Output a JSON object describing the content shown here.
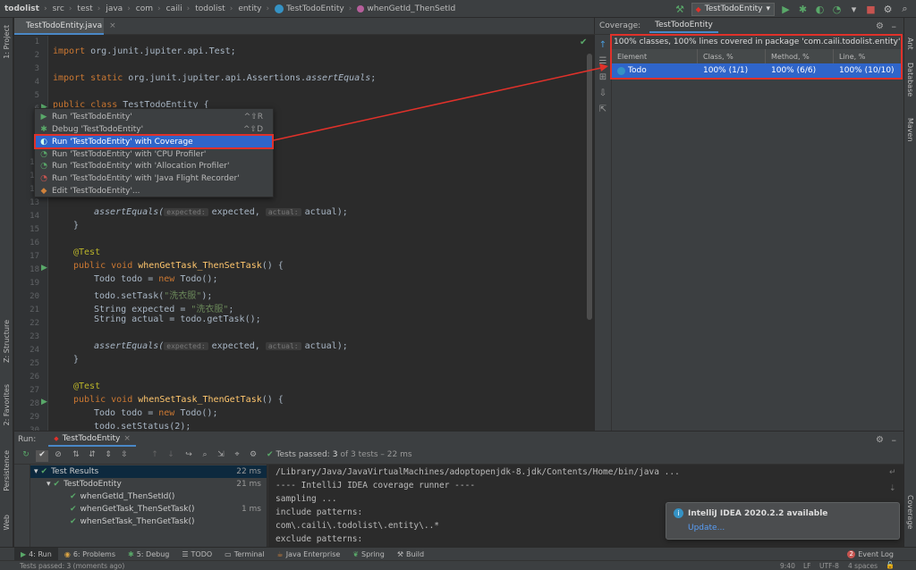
{
  "navbar": {
    "breadcrumbs": [
      "todolist",
      "src",
      "test",
      "java",
      "com",
      "caili",
      "todolist",
      "entity",
      "TestTodoEntity",
      "whenGetId_ThenSetId"
    ],
    "run_config": "TestTodoEntity"
  },
  "left_stripe": {
    "project": "1: Project",
    "structure": "Z: Structure",
    "favorites": "2: Favorites",
    "persistence": "Persistence",
    "web": "Web"
  },
  "right_stripe": {
    "ant": "Ant",
    "database": "Database",
    "maven": "Maven",
    "coverage": "Coverage"
  },
  "editor": {
    "tab": "TestTodoEntity.java",
    "line_numbers": [
      "1",
      "2",
      "3",
      "4",
      "5",
      "6",
      "7",
      "8",
      "9",
      "10",
      "11",
      "12",
      "13",
      "14",
      "15",
      "16",
      "17",
      "18",
      "19",
      "20",
      "21",
      "22",
      "23",
      "24",
      "25",
      "26",
      "27",
      "28",
      "29",
      "30"
    ],
    "lines": {
      "l2_kw": "import",
      "l2_rest": " org.junit.jupiter.api.Test;",
      "l4_kw": "import static",
      "l4_rest": " org.junit.jupiter.api.Assertions.",
      "l4_fn": "assertEquals",
      "l4_end": ";",
      "l6_kw": "public class",
      "l6_rest": " TestTodoEntity {",
      "l14_fn": "assertEquals(",
      "l14_h1": "expected:",
      "l14_a": "expected,",
      "l14_h2": "actual:",
      "l14_b": "actual);",
      "l15": "}",
      "l17": "@Test",
      "l18_kw": "public void",
      "l18_fn": "whenGetTask_ThenSetTask",
      "l18_end": "() {",
      "l19_a": "Todo todo = ",
      "l19_kw": "new",
      "l19_b": " Todo();",
      "l20_a": "todo.setTask(",
      "l20_st": "\"洗衣服\"",
      "l20_b": ");",
      "l21_a": "String expected = ",
      "l21_st": "\"洗衣服\"",
      "l21_b": ";",
      "l22": "String actual = todo.getTask();",
      "l24_fn": "assertEquals(",
      "l24_h1": "expected:",
      "l24_a": "expected,",
      "l24_h2": "actual:",
      "l24_b": "actual);",
      "l25": "}",
      "l27": "@Test",
      "l28_kw": "public void",
      "l28_fn": "whenSetTask_ThenGetTask",
      "l28_end": "() {",
      "l29_a": "Todo todo = ",
      "l29_kw": "new",
      "l29_b": " Todo();",
      "l30": "todo.setStatus(2);"
    }
  },
  "popup_menu": [
    {
      "label": "Run 'TestTodoEntity'",
      "shortcut": "^⇧R",
      "icon": "run-icon"
    },
    {
      "label": "Debug 'TestTodoEntity'",
      "shortcut": "^⇧D",
      "icon": "debug-icon"
    },
    {
      "label": "Run 'TestTodoEntity' with Coverage",
      "shortcut": "",
      "icon": "coverage-icon"
    },
    {
      "label": "Run 'TestTodoEntity' with 'CPU Profiler'",
      "shortcut": "",
      "icon": "profiler-icon"
    },
    {
      "label": "Run 'TestTodoEntity' with 'Allocation Profiler'",
      "shortcut": "",
      "icon": "profiler-icon"
    },
    {
      "label": "Run 'TestTodoEntity' with 'Java Flight Recorder'",
      "shortcut": "",
      "icon": "profiler-icon"
    },
    {
      "label": "Edit 'TestTodoEntity'...",
      "shortcut": "",
      "icon": "edit-icon"
    }
  ],
  "coverage": {
    "title": "Coverage:",
    "tab": "TestTodoEntity",
    "summary": "100% classes, 100% lines covered in package 'com.caili.todolist.entity'",
    "columns": [
      "Element",
      "Class, %",
      "Method, %",
      "Line, %"
    ],
    "row": {
      "element": "Todo",
      "class": "100% (1/1)",
      "method": "100% (6/6)",
      "line": "100% (10/10)"
    }
  },
  "run": {
    "label": "Run:",
    "tab": "TestTodoEntity",
    "status_prefix": "Tests passed:",
    "status_count": "3",
    "status_rest": "of 3 tests – 22 ms",
    "tree": [
      {
        "label": "Test Results",
        "time": "22 ms"
      },
      {
        "label": "TestTodoEntity",
        "time": "21 ms"
      },
      {
        "label": "whenGetId_ThenSetId()",
        "time": ""
      },
      {
        "label": "whenGetTask_ThenSetTask()",
        "time": "1 ms"
      },
      {
        "label": "whenSetTask_ThenGetTask()",
        "time": ""
      }
    ],
    "console": [
      "/Library/Java/JavaVirtualMachines/adoptopenjdk-8.jdk/Contents/Home/bin/java ...",
      "---- IntelliJ IDEA coverage runner ----",
      "sampling ...",
      "include patterns:",
      "com\\.caili\\.todolist\\.entity\\..*",
      "exclude patterns:"
    ]
  },
  "notification": {
    "title": "IntelliJ IDEA 2020.2.2 available",
    "link": "Update..."
  },
  "tool_tabs": [
    "4: Run",
    "6: Problems",
    "5: Debug",
    "TODO",
    "Terminal",
    "Java Enterprise",
    "Spring",
    "Build"
  ],
  "event_log": "Event Log",
  "event_count": "2",
  "status": {
    "left": "Tests passed: 3 (moments ago)",
    "pos": "9:40",
    "sep": "LF",
    "enc": "UTF-8",
    "indent": "4 spaces"
  },
  "colors": {
    "accent": "#2f65ca",
    "highlight": "#e0312a",
    "pass": "#59a869"
  }
}
